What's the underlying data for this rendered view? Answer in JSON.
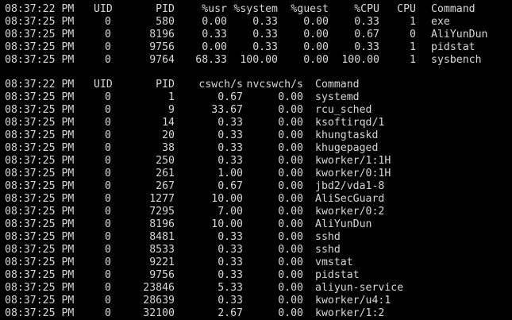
{
  "cpu_table": {
    "header": {
      "time": "08:37:22 PM",
      "uid": "UID",
      "pid": "PID",
      "usr": "%usr",
      "system": "%system",
      "guest": "%guest",
      "cpu_pct": "%CPU",
      "cpu": "CPU",
      "command": "Command"
    },
    "rows": [
      {
        "time": "08:37:25 PM",
        "uid": "0",
        "pid": "580",
        "usr": "0.00",
        "system": "0.33",
        "guest": "0.00",
        "cpu_pct": "0.33",
        "cpu": "1",
        "command": "exe"
      },
      {
        "time": "08:37:25 PM",
        "uid": "0",
        "pid": "8196",
        "usr": "0.33",
        "system": "0.33",
        "guest": "0.00",
        "cpu_pct": "0.67",
        "cpu": "0",
        "command": "AliYunDun"
      },
      {
        "time": "08:37:25 PM",
        "uid": "0",
        "pid": "9756",
        "usr": "0.00",
        "system": "0.33",
        "guest": "0.00",
        "cpu_pct": "0.33",
        "cpu": "1",
        "command": "pidstat"
      },
      {
        "time": "08:37:25 PM",
        "uid": "0",
        "pid": "9764",
        "usr": "68.33",
        "system": "100.00",
        "guest": "0.00",
        "cpu_pct": "100.00",
        "cpu": "1",
        "command": "sysbench"
      }
    ]
  },
  "cswch_table": {
    "header": {
      "time": "08:37:22 PM",
      "uid": "UID",
      "pid": "PID",
      "cswch": "cswch/s",
      "nvcswch": "nvcswch/s",
      "command": "Command"
    },
    "rows": [
      {
        "time": "08:37:25 PM",
        "uid": "0",
        "pid": "1",
        "cswch": "0.67",
        "nvcswch": "0.00",
        "command": "systemd"
      },
      {
        "time": "08:37:25 PM",
        "uid": "0",
        "pid": "9",
        "cswch": "33.67",
        "nvcswch": "0.00",
        "command": "rcu_sched"
      },
      {
        "time": "08:37:25 PM",
        "uid": "0",
        "pid": "14",
        "cswch": "0.33",
        "nvcswch": "0.00",
        "command": "ksoftirqd/1"
      },
      {
        "time": "08:37:25 PM",
        "uid": "0",
        "pid": "20",
        "cswch": "0.33",
        "nvcswch": "0.00",
        "command": "khungtaskd"
      },
      {
        "time": "08:37:25 PM",
        "uid": "0",
        "pid": "38",
        "cswch": "0.33",
        "nvcswch": "0.00",
        "command": "khugepaged"
      },
      {
        "time": "08:37:25 PM",
        "uid": "0",
        "pid": "250",
        "cswch": "0.33",
        "nvcswch": "0.00",
        "command": "kworker/1:1H"
      },
      {
        "time": "08:37:25 PM",
        "uid": "0",
        "pid": "261",
        "cswch": "1.00",
        "nvcswch": "0.00",
        "command": "kworker/0:1H"
      },
      {
        "time": "08:37:25 PM",
        "uid": "0",
        "pid": "267",
        "cswch": "0.67",
        "nvcswch": "0.00",
        "command": "jbd2/vda1-8"
      },
      {
        "time": "08:37:25 PM",
        "uid": "0",
        "pid": "1277",
        "cswch": "10.00",
        "nvcswch": "0.00",
        "command": "AliSecGuard"
      },
      {
        "time": "08:37:25 PM",
        "uid": "0",
        "pid": "7295",
        "cswch": "7.00",
        "nvcswch": "0.00",
        "command": "kworker/0:2"
      },
      {
        "time": "08:37:25 PM",
        "uid": "0",
        "pid": "8196",
        "cswch": "10.00",
        "nvcswch": "0.00",
        "command": "AliYunDun"
      },
      {
        "time": "08:37:25 PM",
        "uid": "0",
        "pid": "8481",
        "cswch": "0.33",
        "nvcswch": "0.00",
        "command": "sshd"
      },
      {
        "time": "08:37:25 PM",
        "uid": "0",
        "pid": "8533",
        "cswch": "0.33",
        "nvcswch": "0.00",
        "command": "sshd"
      },
      {
        "time": "08:37:25 PM",
        "uid": "0",
        "pid": "9221",
        "cswch": "0.33",
        "nvcswch": "0.00",
        "command": "vmstat"
      },
      {
        "time": "08:37:25 PM",
        "uid": "0",
        "pid": "9756",
        "cswch": "0.33",
        "nvcswch": "0.00",
        "command": "pidstat"
      },
      {
        "time": "08:37:25 PM",
        "uid": "0",
        "pid": "23846",
        "cswch": "5.33",
        "nvcswch": "0.00",
        "command": "aliyun-service"
      },
      {
        "time": "08:37:25 PM",
        "uid": "0",
        "pid": "28639",
        "cswch": "0.33",
        "nvcswch": "0.00",
        "command": "kworker/u4:1"
      },
      {
        "time": "08:37:25 PM",
        "uid": "0",
        "pid": "32100",
        "cswch": "2.67",
        "nvcswch": "0.00",
        "command": "kworker/1:2"
      }
    ]
  }
}
